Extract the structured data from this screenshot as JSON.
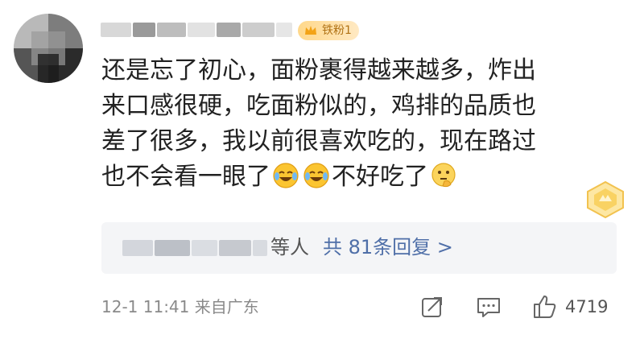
{
  "comment": {
    "fan_badge": "铁粉1",
    "lines": [
      "还是忘了初心，面粉裹得越来越多，炸出",
      "来口感很硬，吃面粉似的，鸡排的品质也",
      "差了很多，我以前很喜欢吃的，现在路过"
    ],
    "last_line_a": "也不会看一眼了",
    "last_line_b": "不好吃了",
    "emojis": [
      "crying-laughing-icon",
      "crying-laughing-icon",
      "thinking-face-icon"
    ]
  },
  "replies": {
    "etal": "等人",
    "count": "共 81条回复 >"
  },
  "footer": {
    "time": "12-1 11:41",
    "source": "来自广东",
    "like_count": "4719",
    "icons": [
      "share-icon",
      "comment-icon",
      "like-icon"
    ]
  },
  "colors": {
    "link": "#4f6fa8",
    "badge_gold": "#ffd88a",
    "reply_bg": "#f4f5f7"
  }
}
